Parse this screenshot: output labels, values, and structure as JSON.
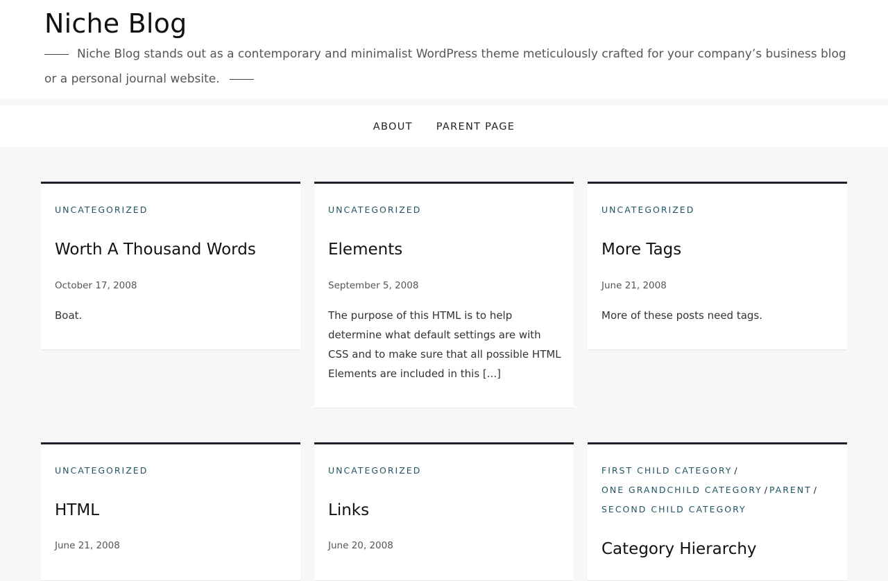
{
  "site": {
    "title": "Niche Blog",
    "tagline": "Niche Blog stands out as a contemporary and minimalist WordPress theme meticulously crafted for your company’s business blog or a personal journal website."
  },
  "nav": {
    "items": [
      {
        "label": "ABOUT"
      },
      {
        "label": "PARENT PAGE"
      }
    ]
  },
  "posts": [
    {
      "category": "UNCATEGORIZED",
      "title": "Worth A Thousand Words",
      "date": "October 17, 2008",
      "excerpt": "Boat."
    },
    {
      "category": "UNCATEGORIZED",
      "title": "Elements",
      "date": "September 5, 2008",
      "excerpt": "The purpose of this HTML is to help determine what default settings are with CSS and to make sure that all possible HTML Elements are included in this [...]"
    },
    {
      "category": "UNCATEGORIZED",
      "title": "More Tags",
      "date": "June 21, 2008",
      "excerpt": "More of these posts need tags."
    },
    {
      "category": "UNCATEGORIZED",
      "title": "HTML",
      "date": "June 21, 2008"
    },
    {
      "category": "UNCATEGORIZED",
      "title": "Links",
      "date": "June 20, 2008"
    },
    {
      "categories": [
        "FIRST CHILD CATEGORY",
        "ONE GRANDCHILD CATEGORY",
        "PARENT",
        "SECOND CHILD CATEGORY"
      ],
      "separator": "/",
      "title": "Category Hierarchy"
    }
  ]
}
